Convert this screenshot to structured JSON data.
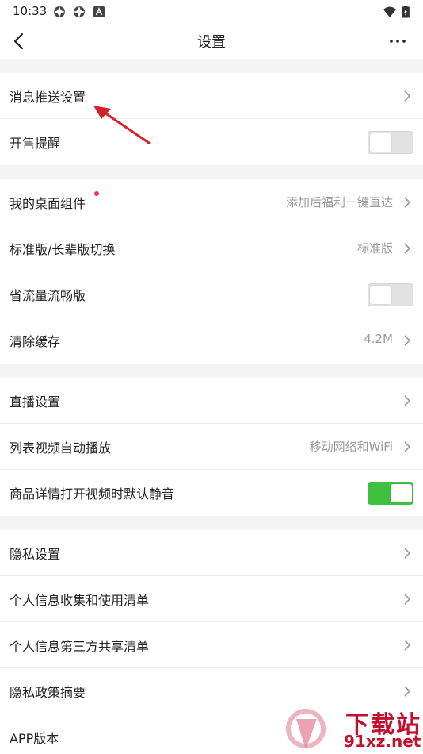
{
  "status_bar": {
    "time": "10:33"
  },
  "header": {
    "title": "设置"
  },
  "sections": {
    "push": {
      "label": "消息推送设置"
    },
    "sale_reminder": {
      "label": "开售提醒",
      "toggle_on": false
    },
    "desktop_widget": {
      "label": "我的桌面组件",
      "value": "添加后福利一键直达"
    },
    "version_switch": {
      "label": "标准版/长辈版切换",
      "value": "标准版"
    },
    "data_saver": {
      "label": "省流量流畅版",
      "toggle_on": false
    },
    "clear_cache": {
      "label": "清除缓存",
      "value": "4.2M"
    },
    "live": {
      "label": "直播设置"
    },
    "autoplay": {
      "label": "列表视频自动播放",
      "value": "移动网络和WiFi"
    },
    "mute": {
      "label": "商品详情打开视频时默认静音",
      "toggle_on": true
    },
    "privacy": {
      "label": "隐私设置"
    },
    "personal_info": {
      "label": "个人信息收集和使用清单"
    },
    "third_party": {
      "label": "个人信息第三方共享清单"
    },
    "privacy_policy": {
      "label": "隐私政策摘要"
    },
    "app_version": {
      "label": "APP版本"
    }
  },
  "watermark": {
    "title": "下载站",
    "site": "91xz.net"
  },
  "colors": {
    "toggle_on": "#3fc13f",
    "dot": "#ff1f78",
    "annotation_arrow": "#d6202a"
  },
  "icons": [
    "wifi-icon",
    "battery-icon",
    "back-arrow-icon",
    "more-icon",
    "chevron-right-icon"
  ]
}
